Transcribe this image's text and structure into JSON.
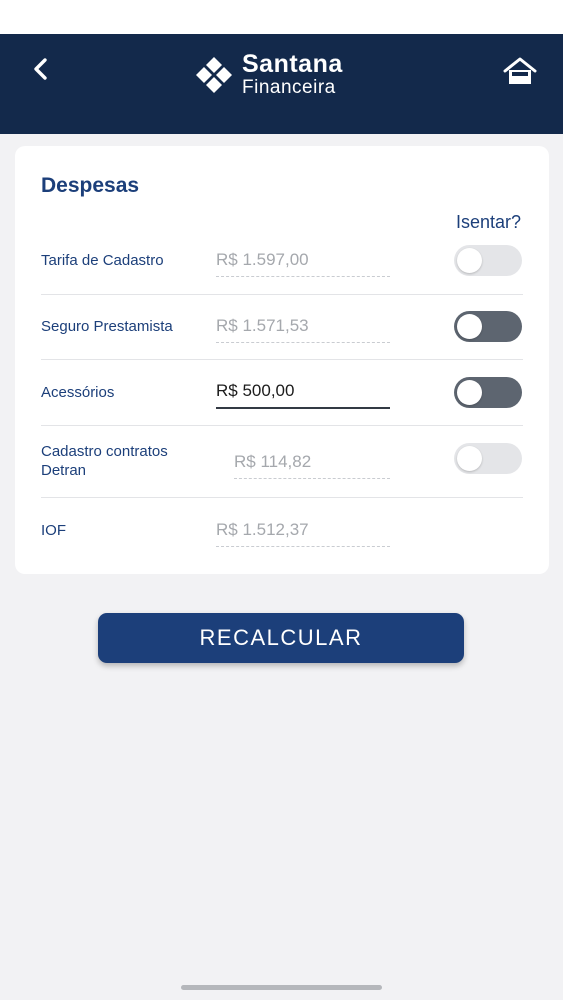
{
  "header": {
    "brand_line1": "Santana",
    "brand_line2": "Financeira",
    "back_icon": "chevron-left-icon",
    "home_icon": "home-icon",
    "background": "#13294b"
  },
  "card": {
    "title": "Despesas",
    "exempt_label": "Isentar?",
    "rows": [
      {
        "label": "Tarifa de Cadastro",
        "value": "R$  1.597,00",
        "toggle": "off",
        "toggle_enabled": false
      },
      {
        "label": "Seguro Prestamista",
        "value": "R$  1.571,53",
        "toggle": "off",
        "toggle_enabled": true
      },
      {
        "label": "Acessórios",
        "value": "R$  500,00",
        "toggle": "off",
        "toggle_enabled": true
      },
      {
        "label_line1": "Cadastro contratos",
        "label_line2": "Detran",
        "value": "R$  114,82",
        "toggle": "off",
        "toggle_enabled": false
      },
      {
        "label": "IOF",
        "value": "R$  1.512,37"
      }
    ]
  },
  "actions": {
    "recalculate_label": "RECALCULAR"
  },
  "colors": {
    "accent": "#1c3f7a",
    "page_background": "#f2f2f4"
  }
}
